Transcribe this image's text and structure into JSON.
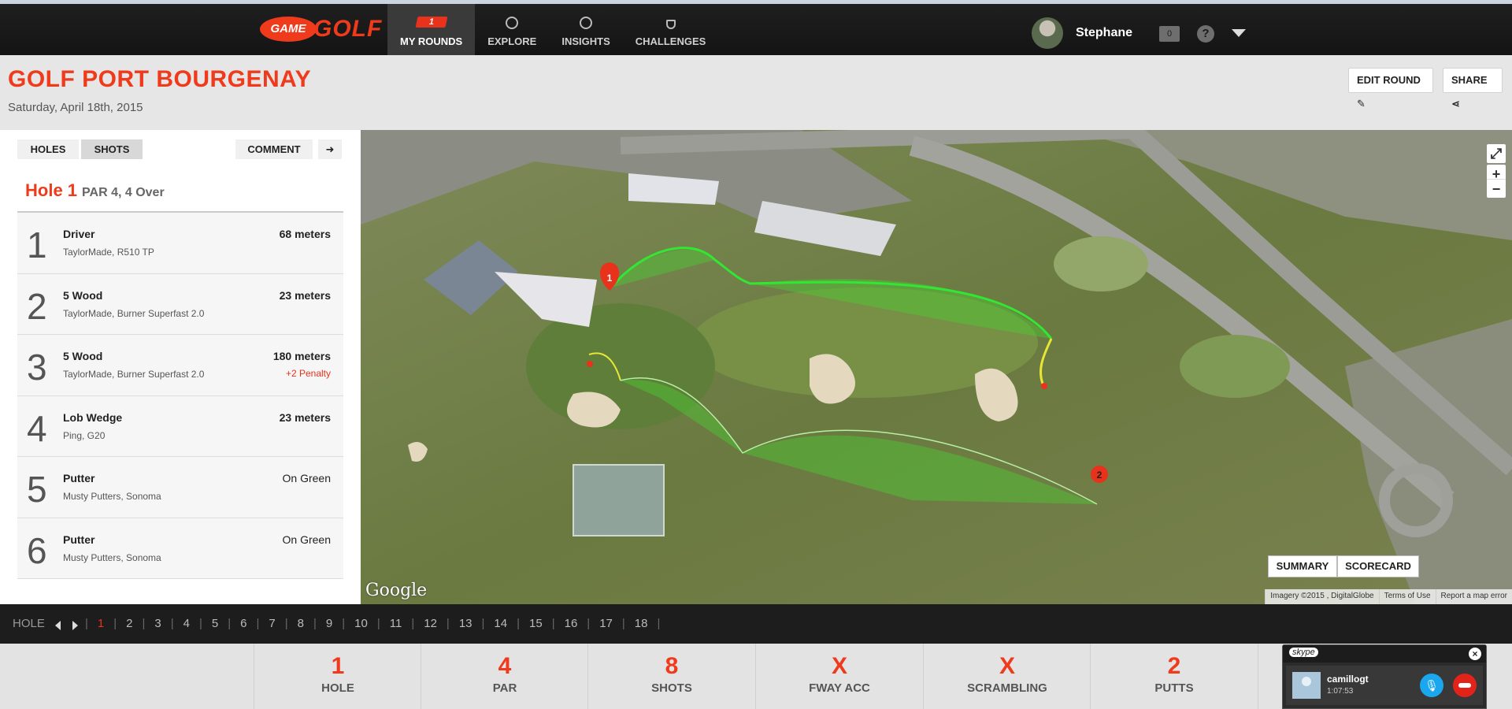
{
  "app": {
    "logo_game": "GAME",
    "logo_golf": "GOLF",
    "nav": [
      {
        "label": "MY ROUNDS",
        "badge": "1",
        "active": true,
        "icon": "flag-icon"
      },
      {
        "label": "EXPLORE",
        "icon": "compass-icon"
      },
      {
        "label": "INSIGHTS",
        "icon": "chart-icon"
      },
      {
        "label": "CHALLENGES",
        "icon": "trophy-icon"
      }
    ],
    "user_name": "Stephane",
    "messages_count": "0"
  },
  "round": {
    "course_name": "GOLF PORT BOURGENAY",
    "date": "Saturday, April 18th, 2015",
    "edit_label": "EDIT ROUND",
    "share_label": "SHARE"
  },
  "panel": {
    "tab_holes": "HOLES",
    "tab_shots": "SHOTS",
    "comment_label": "COMMENT",
    "hole_title": "Hole 1",
    "hole_info": "PAR 4, 4 Over",
    "shots": [
      {
        "num": "1",
        "club": "Driver",
        "model": "TaylorMade, R510 TP",
        "dist": "68 meters",
        "penalty": ""
      },
      {
        "num": "2",
        "club": "5 Wood",
        "model": "TaylorMade, Burner Superfast 2.0",
        "dist": "23 meters",
        "penalty": ""
      },
      {
        "num": "3",
        "club": "5 Wood",
        "model": "TaylorMade, Burner Superfast 2.0",
        "dist": "180 meters",
        "penalty": "+2 Penalty"
      },
      {
        "num": "4",
        "club": "Lob Wedge",
        "model": "Ping, G20",
        "dist": "23 meters",
        "penalty": ""
      },
      {
        "num": "5",
        "club": "Putter",
        "model": "Musty Putters, Sonoma",
        "dist": "On Green",
        "penalty": ""
      },
      {
        "num": "6",
        "club": "Putter",
        "model": "Musty Putters, Sonoma",
        "dist": "On Green",
        "penalty": ""
      }
    ]
  },
  "map": {
    "summary_label": "SUMMARY",
    "scorecard_label": "SCORECARD",
    "google": "Google",
    "imagery": "Imagery ©2015 , DigitalGlobe",
    "terms": "Terms of Use",
    "report": "Report a map error",
    "marker1": "1",
    "marker2": "2",
    "zoom_in": "+",
    "zoom_out": "−"
  },
  "holebar": {
    "label": "HOLE",
    "holes": [
      "1",
      "2",
      "3",
      "4",
      "5",
      "6",
      "7",
      "8",
      "9",
      "10",
      "11",
      "12",
      "13",
      "14",
      "15",
      "16",
      "17",
      "18"
    ],
    "active": "1"
  },
  "stats": [
    {
      "value": "1",
      "label": "HOLE"
    },
    {
      "value": "4",
      "label": "PAR"
    },
    {
      "value": "8",
      "label": "SHOTS"
    },
    {
      "value": "X",
      "label": "FWAY ACC"
    },
    {
      "value": "X",
      "label": "SCRAMBLING"
    },
    {
      "value": "2",
      "label": "PUTTS"
    }
  ],
  "skype": {
    "logo": "skype",
    "caller": "camillogt",
    "duration": "1:07:53"
  },
  "colors": {
    "accent": "#ef3a1c",
    "shot_path": "#33e633",
    "putt_path": "#e6e633"
  }
}
